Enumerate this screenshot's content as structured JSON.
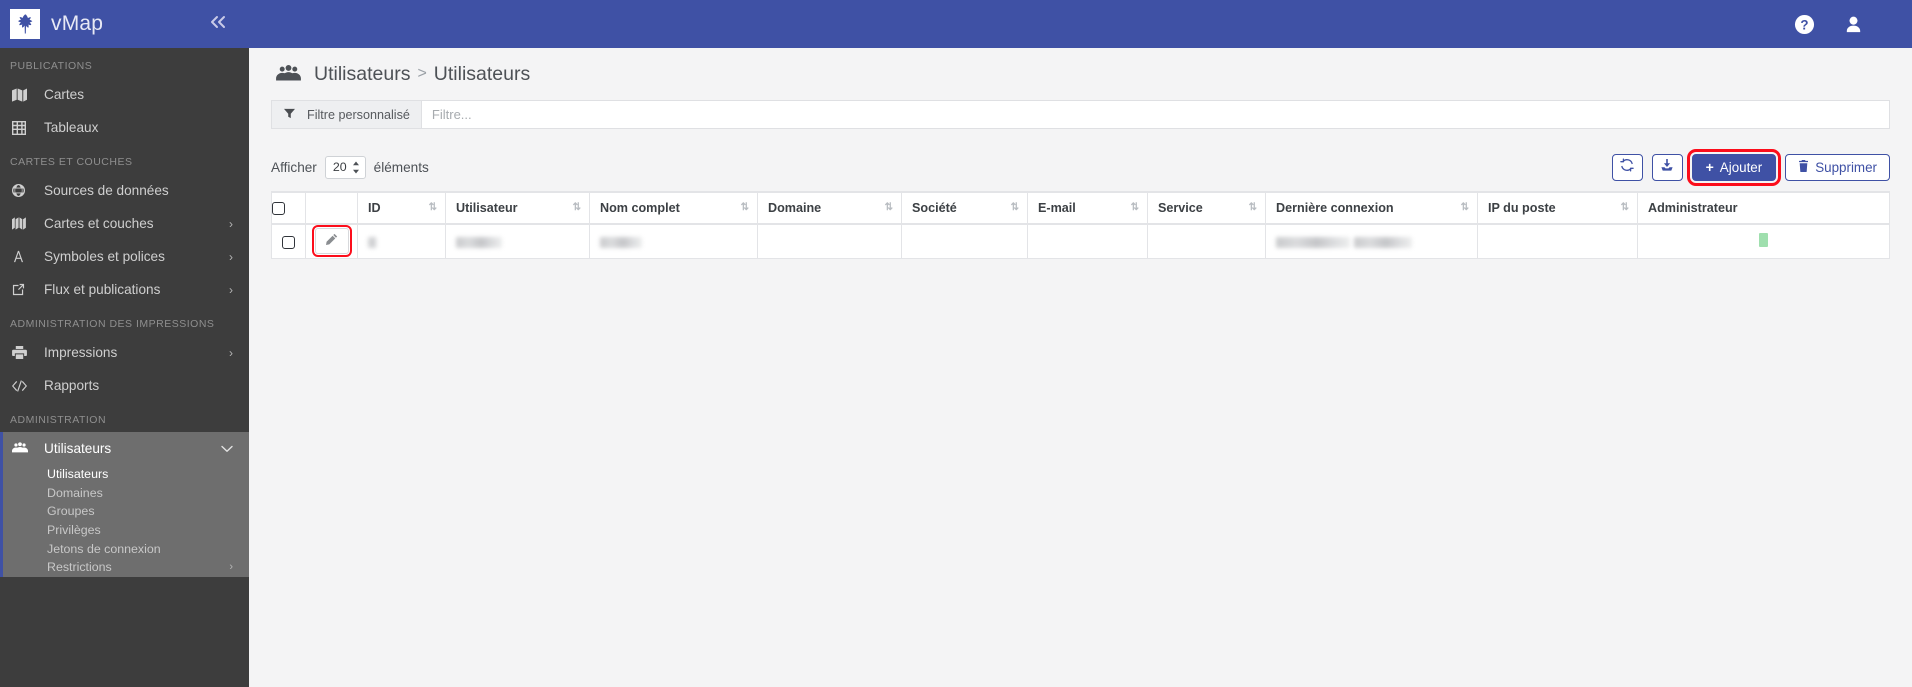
{
  "brand": {
    "title": "vMap",
    "logo_icon": "leaf-logo-icon",
    "collapse_icon": "chevron-double-left-icon",
    "collapse_label": "«",
    "header_color": "#3f51a5"
  },
  "topbar": {
    "help_icon": "question-circle-icon",
    "user_icon": "user-avatar-icon"
  },
  "sidebar": {
    "background_color": "#3d3d3d",
    "active_color": "#6e6e6e",
    "accent_color": "#3f51a5",
    "sections": [
      {
        "title": "PUBLICATIONS",
        "items": [
          {
            "label": "Cartes",
            "icon": "map-icon",
            "caret": ""
          },
          {
            "label": "Tableaux",
            "icon": "table-grid-icon",
            "caret": ""
          }
        ]
      },
      {
        "title": "CARTES ET COUCHES",
        "items": [
          {
            "label": "Sources de données",
            "icon": "globe-icon",
            "caret": ""
          },
          {
            "label": "Cartes et couches",
            "icon": "layers-map-icon",
            "caret": "›"
          },
          {
            "label": "Symboles et polices",
            "icon": "font-a-icon",
            "caret": "›"
          },
          {
            "label": "Flux et publications",
            "icon": "external-link-icon",
            "caret": "›"
          }
        ]
      },
      {
        "title": "ADMINISTRATION DES IMPRESSIONS",
        "items": [
          {
            "label": "Impressions",
            "icon": "printer-icon",
            "caret": "›"
          },
          {
            "label": "Rapports",
            "icon": "code-brackets-icon",
            "caret": ""
          }
        ]
      },
      {
        "title": "ADMINISTRATION",
        "items": [
          {
            "label": "Utilisateurs",
            "icon": "users-group-icon",
            "caret": "⌄",
            "active": true
          }
        ]
      }
    ],
    "submenu": [
      {
        "label": "Utilisateurs",
        "current": true,
        "caret": ""
      },
      {
        "label": "Domaines",
        "current": false,
        "caret": ""
      },
      {
        "label": "Groupes",
        "current": false,
        "caret": ""
      },
      {
        "label": "Privilèges",
        "current": false,
        "caret": ""
      },
      {
        "label": "Jetons de connexion",
        "current": false,
        "caret": ""
      },
      {
        "label": "Restrictions",
        "current": false,
        "caret": "›"
      }
    ]
  },
  "page": {
    "breadcrumb_icon": "users-group-icon",
    "breadcrumb_root": "Utilisateurs",
    "breadcrumb_separator": ">",
    "breadcrumb_current": "Utilisateurs"
  },
  "filter": {
    "icon": "funnel-filter-icon",
    "button_label": "Filtre personnalisé",
    "input_value": "",
    "input_placeholder": "Filtre..."
  },
  "toolbar": {
    "show_label": "Afficher",
    "page_length": "20",
    "elements_label": "éléments",
    "refresh_icon": "refresh-sync-icon",
    "export_icon": "download-export-icon",
    "add_label": "Ajouter",
    "add_icon": "plus-icon",
    "add_highlight_color": "#fc0d1b",
    "delete_label": "Supprimer",
    "delete_icon": "trash-icon"
  },
  "table": {
    "columns": [
      {
        "label": "",
        "sortable": false,
        "key": "select"
      },
      {
        "label": "",
        "sortable": false,
        "key": "edit"
      },
      {
        "label": "ID",
        "sortable": true,
        "key": "id"
      },
      {
        "label": "Utilisateur",
        "sortable": true,
        "key": "user"
      },
      {
        "label": "Nom complet",
        "sortable": true,
        "key": "fullname"
      },
      {
        "label": "Domaine",
        "sortable": true,
        "key": "domain"
      },
      {
        "label": "Société",
        "sortable": true,
        "key": "company"
      },
      {
        "label": "E-mail",
        "sortable": true,
        "key": "email"
      },
      {
        "label": "Service",
        "sortable": true,
        "key": "service"
      },
      {
        "label": "Dernière connexion",
        "sortable": true,
        "key": "lastlogin"
      },
      {
        "label": "IP du poste",
        "sortable": true,
        "key": "ip"
      },
      {
        "label": "Administrateur",
        "sortable": false,
        "key": "admin"
      }
    ],
    "sort_glyph": "⇅",
    "rows": [
      {
        "selected": false,
        "edit_icon": "pencil-edit-icon",
        "edit_highlight_color": "#fc0d1b",
        "id": "",
        "user": "",
        "fullname": "",
        "domain": "",
        "company": "",
        "email": "",
        "service": "",
        "lastlogin": "",
        "ip": "",
        "admin": "yes",
        "redacted": true
      }
    ]
  }
}
